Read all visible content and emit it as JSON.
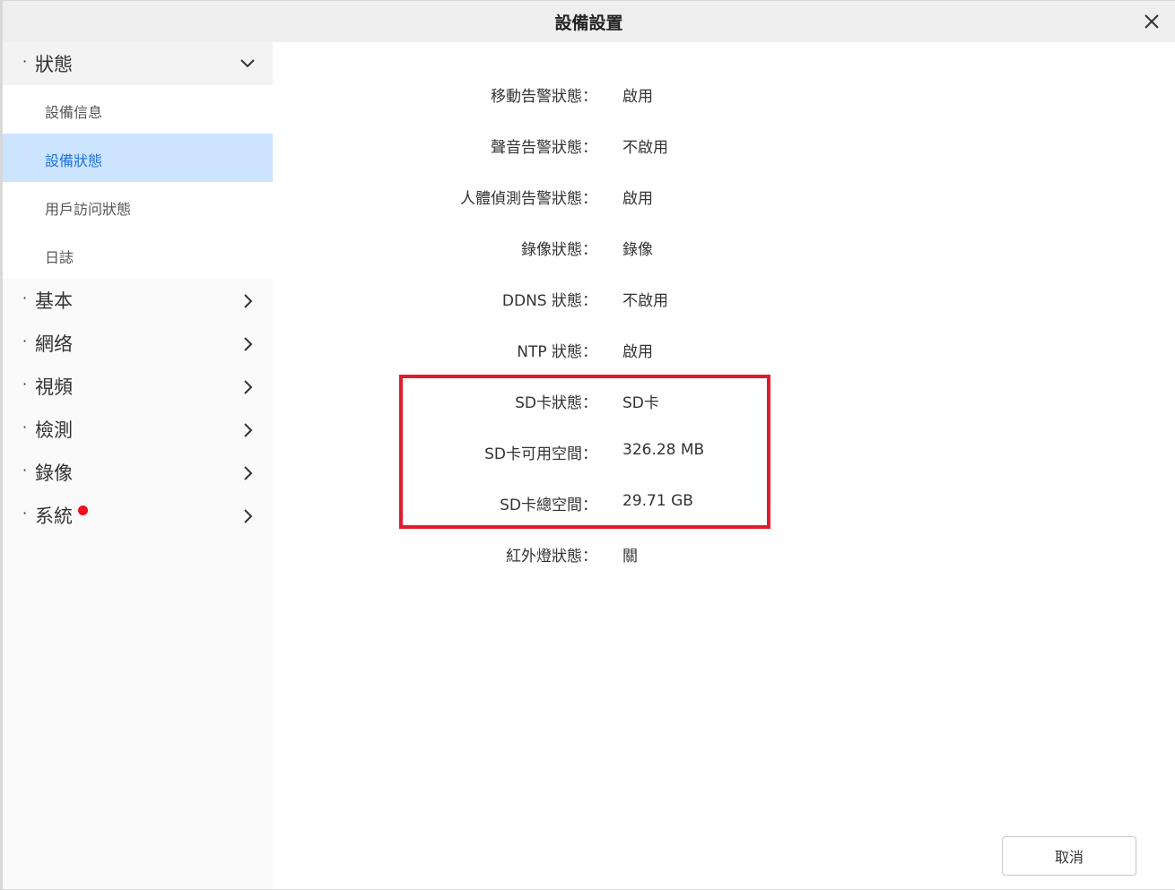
{
  "dialog": {
    "title": "設備設置"
  },
  "sidebar": {
    "categories": [
      {
        "label": "狀態",
        "expanded": true
      },
      {
        "label": "基本"
      },
      {
        "label": "網络"
      },
      {
        "label": "視頻"
      },
      {
        "label": "檢測"
      },
      {
        "label": "錄像"
      },
      {
        "label": "系統",
        "has_alert": true
      }
    ],
    "status_items": [
      {
        "label": "設備信息"
      },
      {
        "label": "設備狀態",
        "active": true
      },
      {
        "label": "用戶訪问狀態"
      },
      {
        "label": "日誌"
      }
    ]
  },
  "status": {
    "rows": [
      {
        "label": "移動告警狀態：",
        "value": "啟用"
      },
      {
        "label": "聲音告警狀態：",
        "value": "不啟用"
      },
      {
        "label": "人體偵測告警狀態：",
        "value": "啟用"
      },
      {
        "label": "錄像狀態：",
        "value": "錄像"
      },
      {
        "label": "DDNS 狀態：",
        "value": "不啟用"
      },
      {
        "label": "NTP 狀態：",
        "value": "啟用"
      },
      {
        "label": "SD卡狀態：",
        "value": "SD卡"
      },
      {
        "label": "SD卡可用空間：",
        "value": "326.28 MB"
      },
      {
        "label": "SD卡總空間：",
        "value": "29.71 GB"
      },
      {
        "label": "紅外燈狀態：",
        "value": "關"
      }
    ]
  },
  "footer": {
    "cancel_label": "取消"
  },
  "colors": {
    "accent": "#1f73d8",
    "active_bg": "#cde4ff",
    "highlight_border": "#e21b2b",
    "alert_dot": "#f00e1d"
  }
}
